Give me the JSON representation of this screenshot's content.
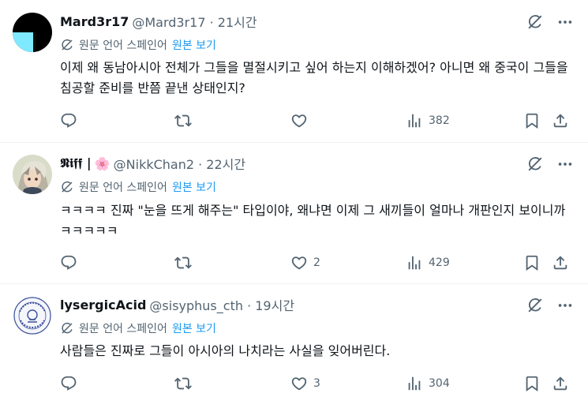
{
  "tweets": [
    {
      "name": "Mard3r17",
      "handle": "@Mard3r17 · 21시간",
      "translated_from": "원문 언어 스페인어",
      "show_original": "원본 보기",
      "text": "이제 왜 동남아시아 전체가 그들을 멸절시키고 싶어 하는지 이해하겠어? 아니면 왜 중국이 그들을 침공할 준비를 반쯤 끝낸 상태인지?",
      "likes": "",
      "views": "382",
      "avatar": "black-cyan-avatar"
    },
    {
      "name": "𝕹𝖎𝖋𝖋 |",
      "name_emoji": "🌸",
      "handle": "@NikkChan2 · 22시간",
      "translated_from": "원문 언어 스페인어",
      "show_original": "원본 보기",
      "text": "ㅋㅋㅋㅋ 진짜 \"눈을 뜨게 해주는\" 타입이야, 왜냐면 이제 그 새끼들이 얼마나 개판인지 보이니까 ㅋㅋㅋㅋㅋ",
      "likes": "2",
      "views": "429",
      "avatar": "anime-character-avatar"
    },
    {
      "name": "lysergicAcid",
      "handle": "@sisyphus_cth · 19시간",
      "translated_from": "원문 언어 스페인어",
      "show_original": "원본 보기",
      "text": "사람들은 진짜로 그들이 아시아의 나치라는 사실을 잊어버린다.",
      "likes": "3",
      "views": "304",
      "avatar": "circular-stamp-avatar"
    }
  ],
  "colors": {
    "text": "#0f1419",
    "muted": "#536471",
    "link": "#1d9bf0",
    "border": "#eff3f4"
  }
}
